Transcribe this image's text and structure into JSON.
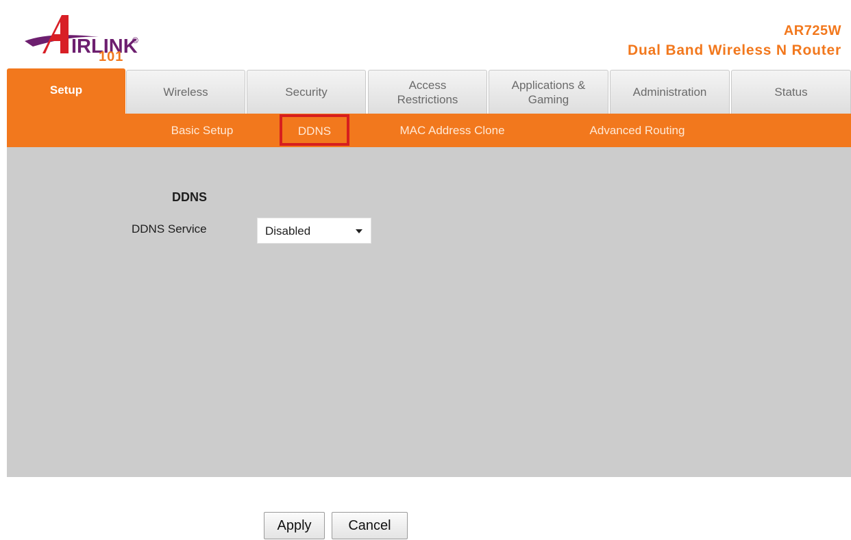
{
  "header": {
    "logo": {
      "name": "IRLINK",
      "suffix": "101",
      "registered_mark": "®"
    },
    "model": "AR725W",
    "product": "Dual Band Wireless N Router"
  },
  "tabs": [
    {
      "label": "Setup",
      "active": true
    },
    {
      "label": "Wireless"
    },
    {
      "label": "Security"
    },
    {
      "label": "Access\nRestrictions"
    },
    {
      "label": "Applications &\nGaming"
    },
    {
      "label": "Administration"
    },
    {
      "label": "Status"
    }
  ],
  "subnav": [
    {
      "label": "Basic Setup"
    },
    {
      "label": "DDNS",
      "highlighted": true
    },
    {
      "label": "MAC Address Clone"
    },
    {
      "label": "Advanced Routing"
    }
  ],
  "ddns": {
    "title": "DDNS",
    "service_label": "DDNS Service",
    "service_value": "Disabled"
  },
  "buttons": {
    "apply": "Apply",
    "cancel": "Cancel"
  },
  "colors": {
    "accent": "#f2781d",
    "highlight": "#d61e1e",
    "content_bg": "#cccccc",
    "logo_purple": "#6d1f6f"
  }
}
